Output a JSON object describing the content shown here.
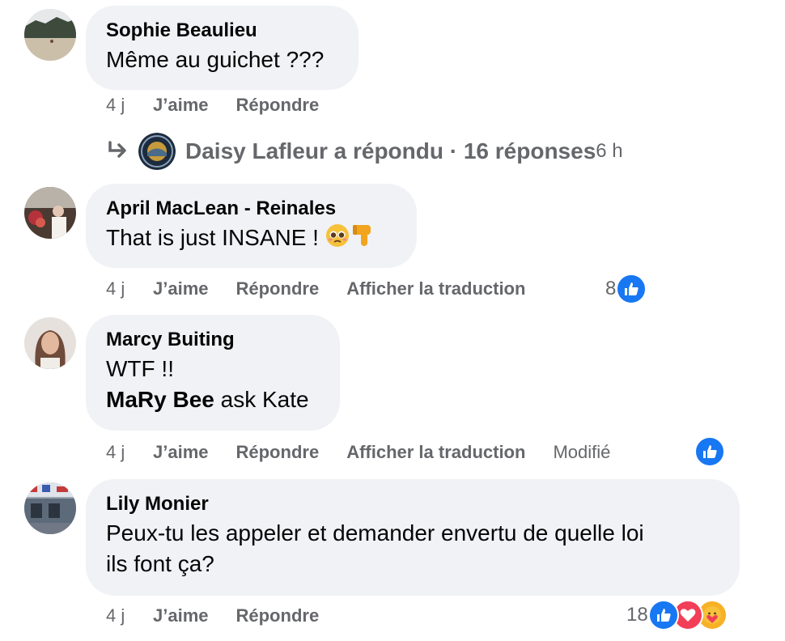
{
  "comments": [
    {
      "author": "Sophie Beaulieu",
      "text": "Même au guichet ???",
      "time": "4 j",
      "like": "J’aime",
      "reply": "Répondre"
    },
    {
      "author": "April MacLean - Reinales",
      "text": "That is just INSANE ! ",
      "time": "4 j",
      "like": "J’aime",
      "reply": "Répondre",
      "translate": "Afficher la traduction",
      "reaction_count": "8",
      "reaction_icons": [
        "like-icon"
      ]
    },
    {
      "author": "Marcy Buiting",
      "text_line1": "WTF !!",
      "mention": "MaRy Bee",
      "text_line2_rest": " ask Kate",
      "time": "4 j",
      "like": "J’aime",
      "reply": "Répondre",
      "translate": "Afficher la traduction",
      "edited": "Modifié",
      "reaction_icons": [
        "like-icon"
      ]
    },
    {
      "author": "Lily Monier",
      "text_line1": "Peux-tu les appeler et demander envertu de quelle loi",
      "text_line2": "ils font ça?",
      "time": "4 j",
      "like": "J’aime",
      "reply": "Répondre",
      "reaction_count": "18",
      "reaction_icons": [
        "like-icon",
        "love-icon",
        "care-icon"
      ]
    }
  ],
  "replies_thread": {
    "text": "Daisy Lafleur a répondu · 16 réponses",
    "time": " 6 h"
  },
  "colors": {
    "bubble": "#f0f2f5",
    "meta_text": "#65676b",
    "like_blue": "#1877f2",
    "love_red": "#f33e58",
    "care_yellow": "#f7b125"
  }
}
